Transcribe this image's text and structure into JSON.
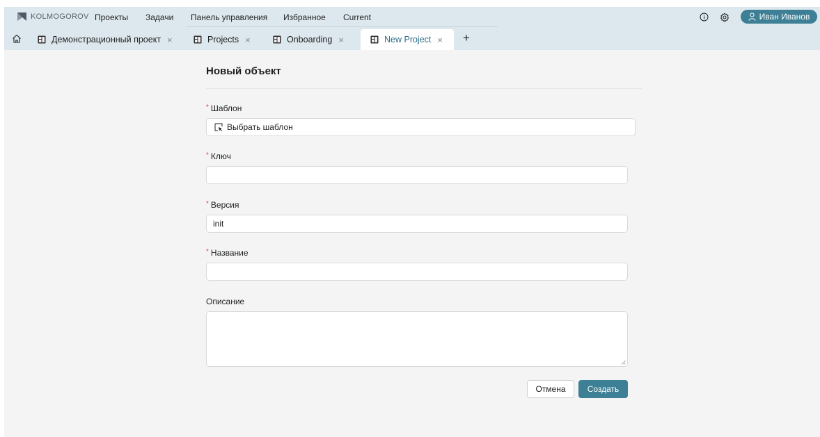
{
  "brand": {
    "name": "KOLMOGOROV",
    "icon": "kolmogorov-logo"
  },
  "nav": {
    "items": [
      {
        "label": "Проекты"
      },
      {
        "label": "Задачи"
      },
      {
        "label": "Панель управления"
      },
      {
        "label": "Избранное"
      },
      {
        "label": "Current"
      }
    ]
  },
  "header_actions": {
    "info_icon": "info-icon",
    "settings_icon": "gear-icon",
    "user_name": "Иван Иванов",
    "user_icon": "user-icon"
  },
  "tabs": [
    {
      "label": "Демонстрационный проект",
      "icon": "board-icon",
      "active": false
    },
    {
      "label": "Projects",
      "icon": "board-icon",
      "active": false
    },
    {
      "label": "Onboarding",
      "icon": "board-icon",
      "active": false
    },
    {
      "label": "New Project",
      "icon": "board-icon",
      "active": true
    }
  ],
  "tab_close_glyph": "×",
  "add_tab_glyph": "+",
  "form": {
    "title": "Новый объект",
    "required_mark": "*",
    "template": {
      "label": "Шаблон",
      "button_label": "Выбрать шаблон",
      "icon": "select-cursor-icon"
    },
    "key": {
      "label": "Ключ",
      "value": ""
    },
    "version": {
      "label": "Версия",
      "value": "init"
    },
    "name": {
      "label": "Название",
      "value": ""
    },
    "description": {
      "label": "Описание",
      "value": ""
    }
  },
  "actions": {
    "cancel_label": "Отмена",
    "create_label": "Создать"
  },
  "colors": {
    "accent": "#3d7f95",
    "nav_bg": "#dde8ee",
    "page_bg": "#f4f4f4",
    "required": "#e0433a"
  }
}
